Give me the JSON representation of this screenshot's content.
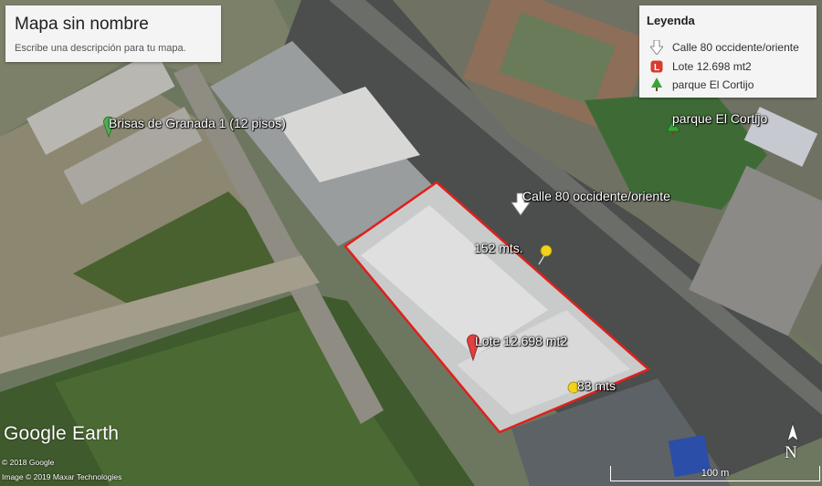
{
  "map_card": {
    "title": "Mapa sin nombre",
    "description": "Escribe una descripción para tu mapa."
  },
  "legend": {
    "heading": "Leyenda",
    "items": [
      {
        "label": "Calle 80 occidente/oriente",
        "icon": "white-arrow-icon",
        "color": "#ffffff"
      },
      {
        "label": "Lote 12.698 mt2",
        "icon": "red-square-L-icon",
        "color": "#d93a2e"
      },
      {
        "label": "parque El Cortijo",
        "icon": "green-tree-icon",
        "color": "#3aa43a"
      }
    ]
  },
  "map_labels": {
    "brisas": "Brisas de Granada 1 (12 pisos)",
    "calle80": "Calle 80 occidente/oriente",
    "parque": "parque El Cortijo",
    "m152": "152 mts.",
    "lote": "Lote 12.698 mt2",
    "m83": "83 mts"
  },
  "branding": {
    "logo": "Google Earth",
    "copyright1": "© 2018 Google",
    "copyright2": "Image © 2019 Maxar Technologies"
  },
  "scale_label": "100 m",
  "compass_label": "N",
  "colors": {
    "lot_outline": "#e0201c",
    "pushpin": "#f2d21a",
    "green_pin": "#4caf50",
    "red_pin": "#e04040"
  }
}
